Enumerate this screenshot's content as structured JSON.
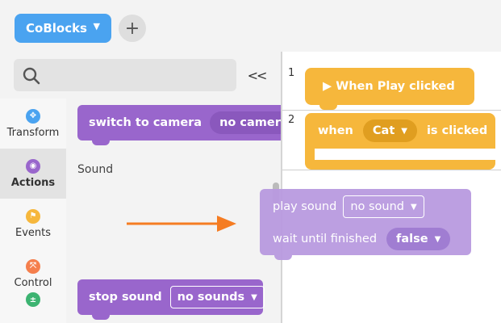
{
  "header": {
    "project_label": "CoBlocks",
    "add_label": "+"
  },
  "search": {
    "placeholder": ""
  },
  "categories": [
    {
      "label": "Transform",
      "color": "#4aa3f0",
      "icon": "transform-icon",
      "glyph": "✥"
    },
    {
      "label": "Actions",
      "color": "#9966cc",
      "icon": "eye-icon",
      "glyph": "◉"
    },
    {
      "label": "Events",
      "color": "#f6b73c",
      "icon": "flag-icon",
      "glyph": "⚑"
    },
    {
      "label": "Control",
      "color": "#f57f4d",
      "icon": "arrows-icon",
      "glyph": "⤧"
    },
    {
      "label": "",
      "color": "#3cb371",
      "icon": "plus-minus-icon",
      "glyph": "±"
    }
  ],
  "palette": {
    "camera_block": {
      "label": "switch to camera",
      "value": "no camera it"
    },
    "sound_section": "Sound",
    "stop_block": {
      "label": "stop sound",
      "value": "no sounds"
    }
  },
  "workspace": {
    "rows": [
      {
        "number": "1",
        "block": "▶ When Play clicked"
      },
      {
        "number": "2",
        "prefix": "when",
        "target": "Cat",
        "suffix": "is clicked"
      }
    ]
  },
  "dragged_block": {
    "line1": "play sound",
    "line1_value": "no sound",
    "line2": "wait until finished",
    "line2_value": "false"
  },
  "colors": {
    "actions_purple": "#9966cc",
    "events_orange": "#f6b73c",
    "accent_blue": "#4aa3f0",
    "arrow_orange": "#f57c22"
  }
}
